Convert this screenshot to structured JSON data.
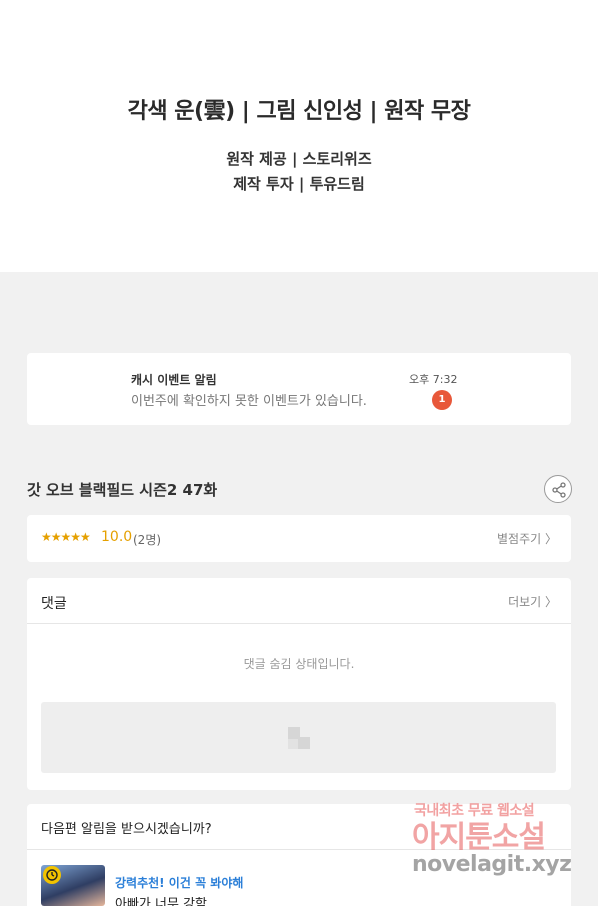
{
  "credits": {
    "line1": "각색 운(雲) | 그림 신인성 | 원작 무장",
    "line2": "원작 제공 | 스토리위즈",
    "line3": "제작 투자 | 투유드림"
  },
  "notification": {
    "title": "캐시 이벤트 알림",
    "body": "이번주에 확인하지 못한 이벤트가 있습니다.",
    "time": "오후 7:32",
    "badge": "1"
  },
  "episode": {
    "title": "갓 오브 블랙필드 시즌2 47화",
    "share_icon": "share-icon"
  },
  "rating": {
    "stars": "★★★★★",
    "score": "10.0",
    "count": "(2명)",
    "rate_link": "별점주기 〉"
  },
  "comments": {
    "heading": "댓글",
    "more": "더보기 〉",
    "hidden_message": "댓글 숨김 상태입니다."
  },
  "next_episode": {
    "question": "다음편 알림을 받으시겠습니까?",
    "recommend_label": "강력추천! 이건 꼭 봐야해",
    "recommend_title": "아빠가 너무 강함"
  },
  "watermark": {
    "line1": "국내최초 무료 웹소설",
    "line2": "아지툰소설",
    "line3": "novelagit.xyz"
  }
}
